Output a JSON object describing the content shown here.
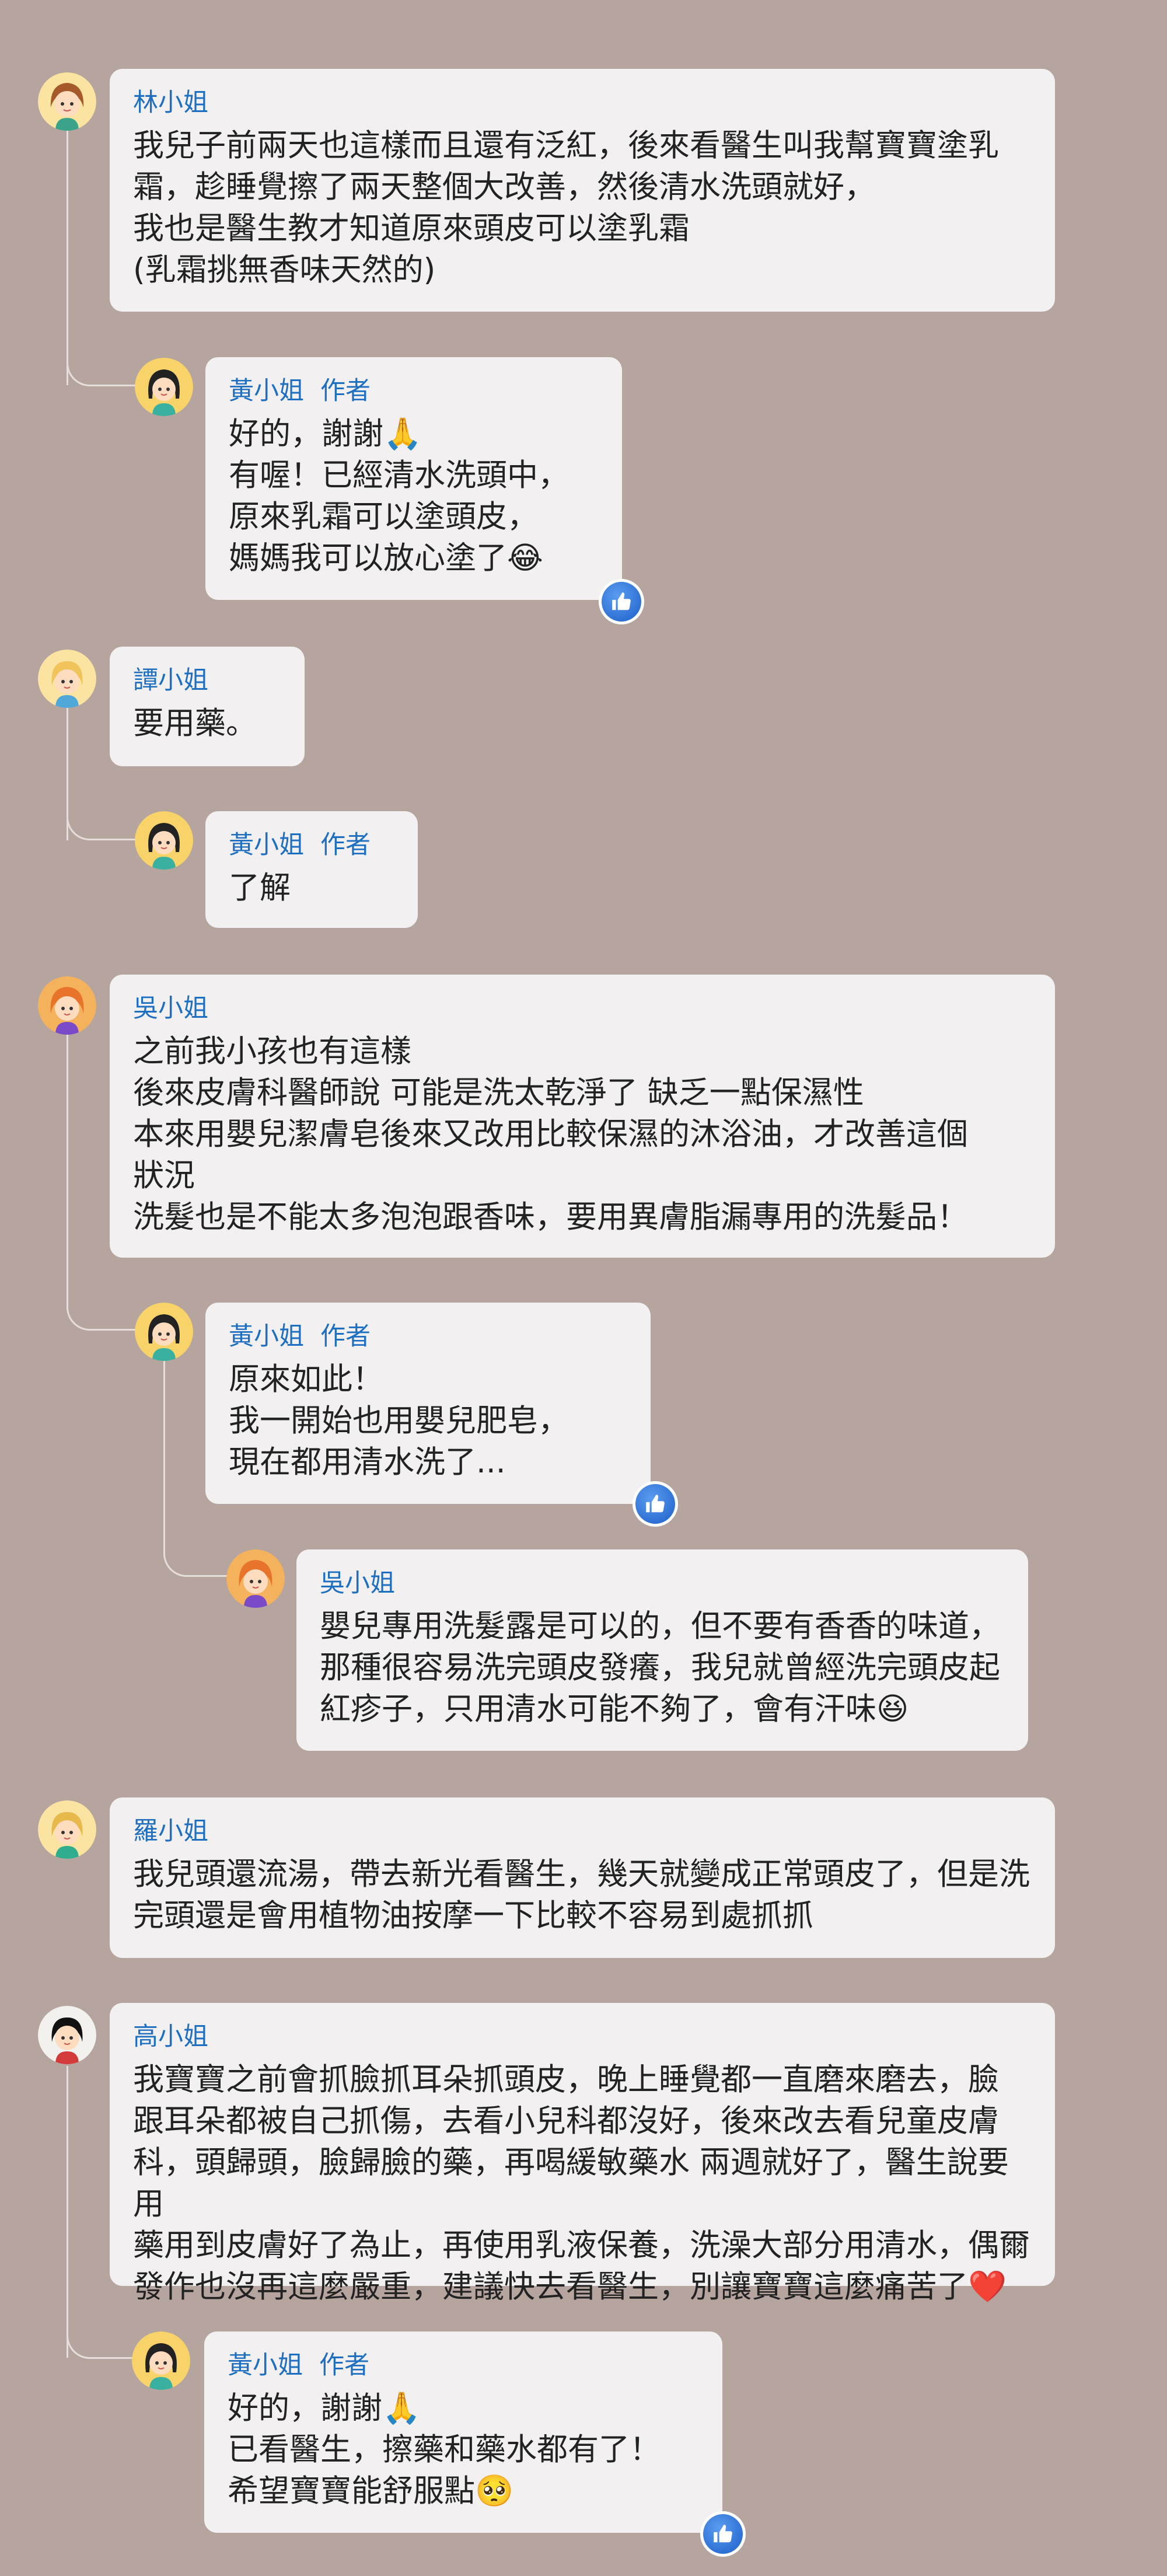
{
  "comments": [
    {
      "name": "林小姐",
      "text": "我兒子前兩天也這樣而且還有泛紅，後來看醫生叫我幫寶寶塗乳\n霜，趁睡覺擦了兩天整個大改善，然後清水洗頭就好，\n我也是醫生教才知道原來頭皮可以塗乳霜\n(乳霜挑無香味天然的)"
    },
    {
      "name": "黃小姐",
      "badge": "作者",
      "text": "好的，謝謝🙏\n有喔！已經清水洗頭中，\n原來乳霜可以塗頭皮，\n媽媽我可以放心塗了😂"
    },
    {
      "name": "譚小姐",
      "text": "要用藥。"
    },
    {
      "name": "黃小姐",
      "badge": "作者",
      "text": "了解"
    },
    {
      "name": "吳小姐",
      "text": "之前我小孩也有這樣\n後來皮膚科醫師說 可能是洗太乾淨了 缺乏一點保濕性\n本來用嬰兒潔膚皂後來又改用比較保濕的沐浴油，才改善這個\n狀況\n洗髮也是不能太多泡泡跟香味，要用異膚脂漏專用的洗髮品！"
    },
    {
      "name": "黃小姐",
      "badge": "作者",
      "text": "原來如此！\n我一開始也用嬰兒肥皂，\n現在都用清水洗了..."
    },
    {
      "name": "吳小姐",
      "text": "嬰兒專用洗髮露是可以的，但不要有香香的味道，\n那種很容易洗完頭皮發癢，我兒就曾經洗完頭皮起\n紅疹子，只用清水可能不夠了，會有汗味😆"
    },
    {
      "name": "羅小姐",
      "text": "我兒頭還流湯，帶去新光看醫生，幾天就變成正常頭皮了，但是洗\n完頭還是會用植物油按摩一下比較不容易到處抓抓"
    },
    {
      "name": "高小姐",
      "text": "我寶寶之前會抓臉抓耳朵抓頭皮，晚上睡覺都一直磨來磨去，臉\n跟耳朵都被自己抓傷，去看小兒科都沒好，後來改去看兒童皮膚\n科，頭歸頭，臉歸臉的藥，再喝緩敏藥水 兩週就好了，醫生說要用\n藥用到皮膚好了為止，再使用乳液保養，洗澡大部分用清水，偶爾\n發作也沒再這麼嚴重，建議快去看醫生，別讓寶寶這麼痛苦了❤️"
    },
    {
      "name": "黃小姐",
      "badge": "作者",
      "text": "好的，謝謝🙏\n已看醫生，擦藥和藥水都有了！\n希望寶寶能舒服點🥺"
    }
  ],
  "icons": {
    "avatar": "avatar-icon",
    "like": "like-icon"
  },
  "colors": {
    "background": "#b6a49f",
    "bubble": "#f2f0f0",
    "name": "#1f6fc1",
    "like": "#2d73d8"
  }
}
